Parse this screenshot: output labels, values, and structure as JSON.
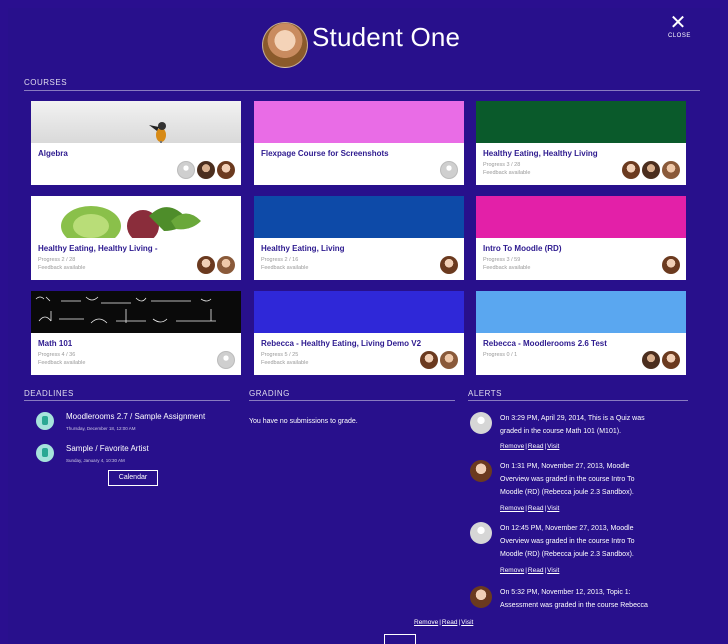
{
  "header": {
    "student_name": "Student One",
    "close_label": "CLOSE"
  },
  "courses": {
    "section_title": "COURSES",
    "items": [
      {
        "title": "Algebra",
        "progress": "",
        "feedback": "",
        "image": "white-bird"
      },
      {
        "title": "Flexpage Course for Screenshots",
        "progress": "",
        "feedback": "",
        "image_color": "#e96ce6"
      },
      {
        "title": "Healthy Eating, Healthy Living",
        "progress": "Progress 3 / 28",
        "feedback": "Feedback available",
        "image_color": "#0a5a2b"
      },
      {
        "title": "Healthy Eating, Healthy Living -",
        "progress": "Progress 2 / 28",
        "feedback": "Feedback available",
        "image": "vegetables"
      },
      {
        "title": "Healthy Eating, Living",
        "progress": "Progress 2 / 16",
        "feedback": "Feedback available",
        "image_color": "#0d4aa8"
      },
      {
        "title": "Intro To Moodle (RD)",
        "progress": "Progress 3 / 59",
        "feedback": "Feedback available",
        "image_color": "#e320a8"
      },
      {
        "title": "Math 101",
        "progress": "Progress 4 / 36",
        "feedback": "Feedback available",
        "image": "chalkboard"
      },
      {
        "title": "Rebecca - Healthy Eating, Living Demo V2",
        "progress": "Progress 5 / 25",
        "feedback": "Feedback available",
        "image_color": "#2f28d8"
      },
      {
        "title": "Rebecca - Moodlerooms 2.6 Test",
        "progress": "Progress 0 / 1",
        "feedback": "",
        "image_color": "#5aa7f0"
      }
    ]
  },
  "deadlines": {
    "section_title": "DEADLINES",
    "items": [
      {
        "title": "Moodlerooms 2.7 / Sample Assignment",
        "date": "Thursday, December 18, 12:00 AM"
      },
      {
        "title": "Sample / Favorite Artist",
        "date": "Sunday, January 4, 10:30 AM"
      }
    ],
    "calendar_button": "Calendar"
  },
  "grading": {
    "section_title": "GRADING",
    "message": "You have no submissions to grade."
  },
  "alerts": {
    "section_title": "ALERTS",
    "link_remove": "Remove",
    "link_read": "Read",
    "link_visit": "Visit",
    "separator": "|",
    "items": [
      {
        "lines": [
          "On 3:29 PM, April 29, 2014, This is a Quiz was",
          "graded in the course Math 101 (M101)."
        ],
        "avatar": "generic"
      },
      {
        "lines": [
          "On 1:31 PM, November 27, 2013, Moodle",
          "Overview was graded in the course Intro To",
          "Moodle (RD) (Rebecca joule 2.3 Sandbox)."
        ],
        "avatar": "person"
      },
      {
        "lines": [
          "On 12:45 PM, November 27, 2013, Moodle",
          "Overview was graded in the course Intro To",
          "Moodle (RD) (Rebecca joule 2.3 Sandbox)."
        ],
        "avatar": "generic"
      },
      {
        "lines": [
          "On 5:32 PM, November 12, 2013, Topic 1:",
          "Assessment was graded in the course Rebecca"
        ],
        "avatar": "person"
      }
    ]
  },
  "colors": {
    "background": "#28108c",
    "course_title": "#2d1a8f"
  }
}
